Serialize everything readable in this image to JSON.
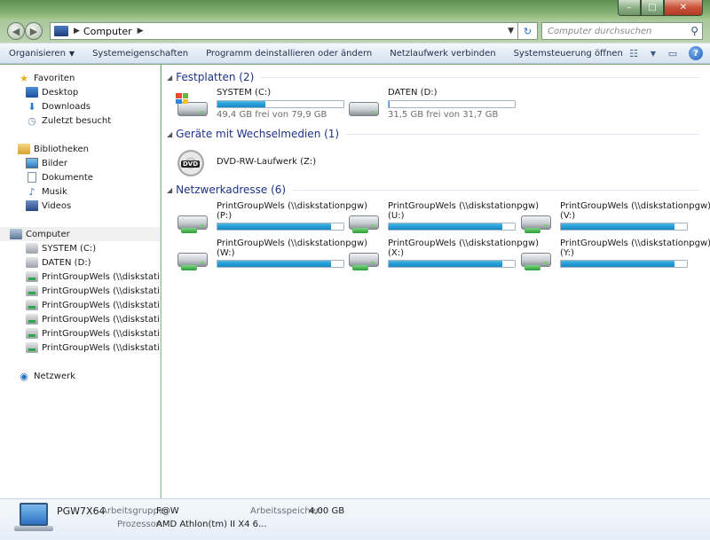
{
  "window": {
    "caption_minimize": "–",
    "caption_maximize": "□",
    "caption_close": "✕"
  },
  "address": {
    "back_glyph": "◀",
    "forward_glyph": "▶",
    "crumb_sep": "▶",
    "crumb": "Computer",
    "crumb_after": "▶",
    "dropdown_glyph": "▼",
    "refresh_glyph": "↻",
    "search_placeholder": "Computer durchsuchen",
    "search_glyph": "⚲"
  },
  "toolbar": {
    "organize": "Organisieren",
    "organize_caret": "▼",
    "system_properties": "Systemeigenschaften",
    "uninstall": "Programm deinstallieren oder ändern",
    "map_drive": "Netzlaufwerk verbinden",
    "control_panel": "Systemsteuerung öffnen",
    "view_glyph": "☷",
    "view_caret": "▼",
    "preview_glyph": "▭",
    "help_glyph": "?"
  },
  "sidebar": {
    "favorites": "Favoriten",
    "desktop": "Desktop",
    "downloads": "Downloads",
    "recent": "Zuletzt besucht",
    "libraries": "Bibliotheken",
    "pictures": "Bilder",
    "documents": "Dokumente",
    "music": "Musik",
    "videos": "Videos",
    "computer": "Computer",
    "drives": [
      "SYSTEM (C:)",
      "DATEN (D:)"
    ],
    "network_drives": [
      "PrintGroupWels (\\\\diskstationpgw",
      "PrintGroupWels (\\\\diskstationpgw",
      "PrintGroupWels (\\\\diskstationpgw",
      "PrintGroupWels (\\\\diskstationpgw",
      "PrintGroupWels (\\\\diskstationpgw",
      "PrintGroupWels (\\\\diskstationpgw"
    ],
    "network": "Netzwerk",
    "icons": {
      "star": "★",
      "down": "⬇",
      "recent": "◷",
      "music": "♪",
      "network": "◉"
    }
  },
  "content": {
    "group_arrow": "◢",
    "groups": {
      "hdd": "Festplatten (2)",
      "removable": "Geräte mit Wechselmedien (1)",
      "network": "Netzwerkadresse (6)"
    },
    "hdd": [
      {
        "name": "SYSTEM (C:)",
        "free": "49,4 GB frei von 79,9 GB",
        "used_fraction": 0.38
      },
      {
        "name": "DATEN (D:)",
        "free": "31,5 GB frei von 31,7 GB",
        "used_fraction": 0.01
      }
    ],
    "dvd": {
      "name": "DVD-RW-Laufwerk (Z:)",
      "icon_label": "DVD"
    },
    "network": [
      {
        "name": "PrintGroupWels (\\\\diskstationpgw)",
        "letter": "(P:)",
        "used_fraction": 0.9
      },
      {
        "name": "PrintGroupWels (\\\\diskstationpgw)",
        "letter": "(U:)",
        "used_fraction": 0.9
      },
      {
        "name": "PrintGroupWels (\\\\diskstationpgw)",
        "letter": "(V:)",
        "used_fraction": 0.9
      },
      {
        "name": "PrintGroupWels (\\\\diskstationpgw)",
        "letter": "(W:)",
        "used_fraction": 0.9
      },
      {
        "name": "PrintGroupWels (\\\\diskstationpgw)",
        "letter": "(X:)",
        "used_fraction": 0.9
      },
      {
        "name": "PrintGroupWels (\\\\diskstationpgw)",
        "letter": "(Y:)",
        "used_fraction": 0.9
      }
    ]
  },
  "details": {
    "computer_name": "PGW7X64",
    "workgroup_label": "Arbeitsgruppe:",
    "workgroup_value": "F@W",
    "memory_label": "Arbeitsspeicher:",
    "memory_value": "4,00 GB",
    "cpu_label": "Prozessor:",
    "cpu_value": "AMD Athlon(tm) II X4 6..."
  },
  "colors": {
    "bar_fill": "#26a0da",
    "group_title": "#1e3287"
  }
}
